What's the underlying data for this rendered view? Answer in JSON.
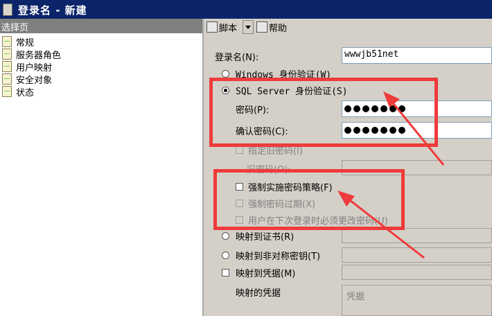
{
  "window": {
    "title": "登录名 - 新建"
  },
  "left_panel": {
    "header": "选择页",
    "items": [
      "常规",
      "服务器角色",
      "用户映射",
      "安全对象",
      "状态"
    ]
  },
  "toolbar": {
    "script_label": "脚本",
    "help_label": "帮助"
  },
  "form": {
    "login_name_label": "登录名(N):",
    "login_name_value": "wwwjb51net",
    "windows_auth_label": "Windows 身份验证(W)",
    "sql_auth_label": "SQL Server 身份验证(S)",
    "password_label": "密码(P):",
    "confirm_password_label": "确认密码(C):",
    "password_dot_count": 7,
    "specify_old_password_label": "指定旧密码(I)",
    "old_password_label": "旧密码(O):",
    "enforce_policy_label": "强制实施密码策略(F)",
    "enforce_expiration_label": "强制密码过期(X)",
    "must_change_label": "用户在下次登录时必须更改密码(U)",
    "map_cert_label": "映射到证书(R)",
    "map_asym_key_label": "映射到非对称密钥(T)",
    "map_credential_label": "映射到凭据(M)",
    "mapped_credentials_label": "映射的凭据",
    "credential_header": "凭据"
  },
  "colors": {
    "title_bar": "#0b246a",
    "annotation": "#ef3b3b",
    "window_bg": "#d4d0c8"
  }
}
